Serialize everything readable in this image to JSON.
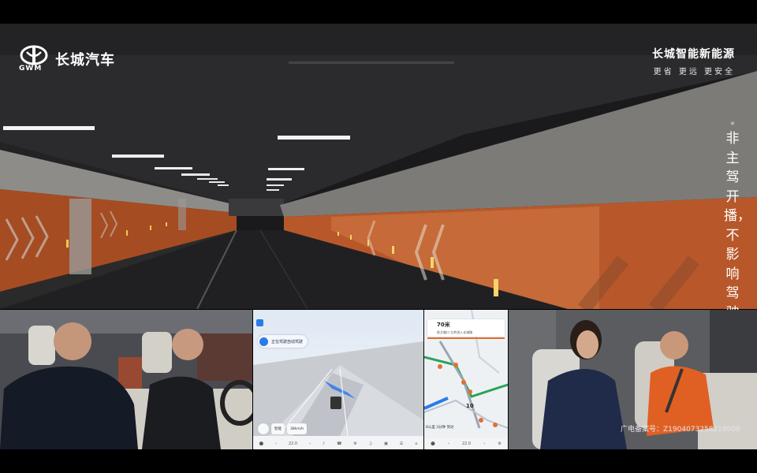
{
  "brand": {
    "logo_text": "长城汽车",
    "logo_sub": "GWM",
    "tagline_title": "长城智能新能源",
    "tagline_sub": "更省  更远  更安全"
  },
  "disclaimer": {
    "mark": "*",
    "text": "非主驾开播，不影响驾驶"
  },
  "center_screen": {
    "chip_label": "正在驾驶自动驾驶",
    "buttons": [
      "智能",
      "38km/h"
    ],
    "taskbar": [
      "⬤",
      "‹",
      "22.0",
      "›",
      "♪",
      "☎",
      "⚙",
      "♫",
      "▣",
      "☰",
      "⌂"
    ]
  },
  "nav_screen": {
    "distance": "70米",
    "road": "前方路口 左转进入长城路",
    "marker": "10",
    "bottom_info": "8公里 3分钟 到达",
    "taskbar": [
      "⬤",
      "‹",
      "22.0",
      "›",
      "⚙"
    ]
  },
  "watermark": "广电备案号：Z1904073258218009",
  "colors": {
    "tunnel_wall": "#c05a2b",
    "tunnel_ceiling": "#2c2c2e",
    "accent_blue": "#2a7bea",
    "route_green": "#2aa35a"
  }
}
